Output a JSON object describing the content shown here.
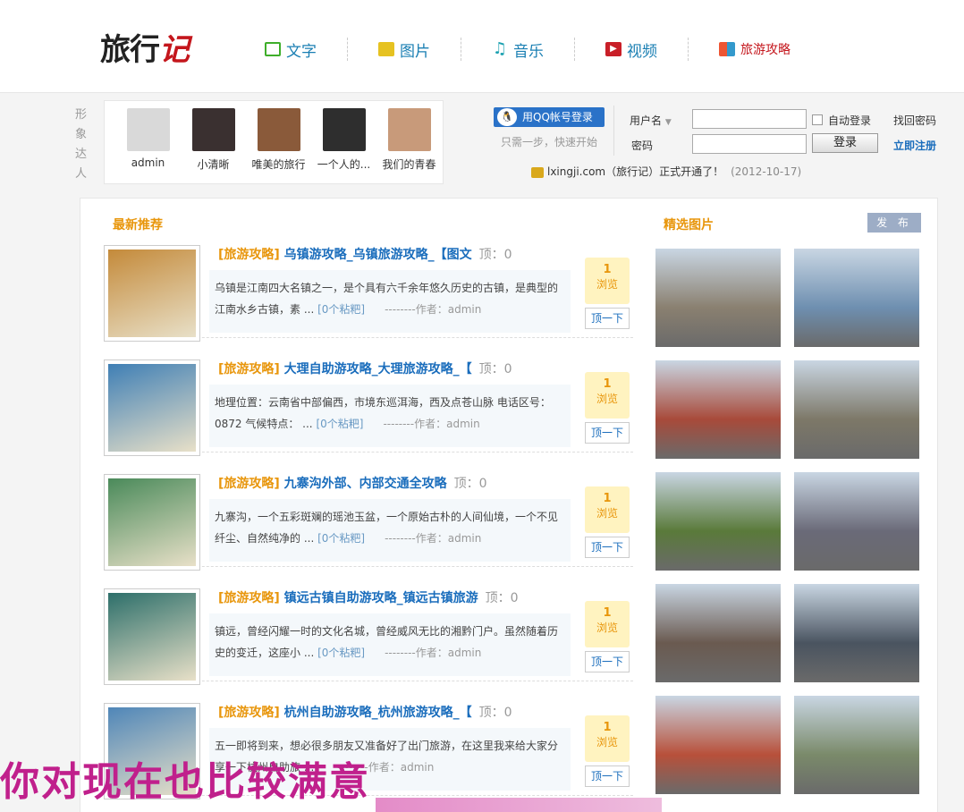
{
  "header": {
    "logo_main": "旅行",
    "logo_accent": "记",
    "nav": [
      {
        "label": "文字",
        "icon": "text-icon"
      },
      {
        "label": "图片",
        "icon": "picture-icon"
      },
      {
        "label": "音乐",
        "icon": "music-icon"
      },
      {
        "label": "视频",
        "icon": "video-icon"
      },
      {
        "label": "旅游攻略",
        "icon": "guide-icon"
      }
    ]
  },
  "stars": {
    "side_label": "形象达人",
    "users": [
      {
        "name": "admin",
        "color": "#d9d9d9"
      },
      {
        "name": "小清晰",
        "color": "#3a3030"
      },
      {
        "name": "唯美的旅行",
        "color": "#8a5a3a"
      },
      {
        "name": "一个人的...",
        "color": "#2e2e2e"
      },
      {
        "name": "我们的青春",
        "color": "#c89a7a"
      }
    ]
  },
  "login": {
    "qq_button": "用QQ帐号登录",
    "qq_sub": "只需一步，快速开始",
    "username_label": "用户名",
    "password_label": "密码",
    "auto_login": "自动登录",
    "find_password": "找回密码",
    "login_button": "登录",
    "register": "立即注册"
  },
  "notice": {
    "text": "lxingji.com（旅行记）正式开通了！",
    "date": "(2012-10-17)"
  },
  "latest": {
    "title": "最新推荐",
    "posts": [
      {
        "cat": "[旅游攻略]",
        "title": "乌镇游攻略_乌镇旅游攻略_【图文",
        "top": "顶：0",
        "body1": "乌镇是江南四大名镇之一，是个具有六千余年悠久历史的古镇，是典型的",
        "body2": "江南水乡古镇，素 ...",
        "more": "[0个粘粑]",
        "author": "--------作者：admin",
        "votes": "1",
        "vote_label": "浏览",
        "ding": "顶一下",
        "color": "#c48a3a"
      },
      {
        "cat": "[旅游攻略]",
        "title": "大理自助游攻略_大理旅游攻略_【",
        "top": "顶：0",
        "body1": "地理位置：云南省中部偏西，市境东巡洱海，西及点苍山脉 电话区号：",
        "body2": "0872 气候特点： ...",
        "more": "[0个粘粑]",
        "author": "--------作者：admin",
        "votes": "1",
        "vote_label": "浏览",
        "ding": "顶一下",
        "color": "#3f7fb5"
      },
      {
        "cat": "[旅游攻略]",
        "title": "九寨沟外部、内部交通全攻略",
        "top": "顶：0",
        "body1": "九寨沟，一个五彩斑斓的瑶池玉盆，一个原始古朴的人间仙境，一个不见",
        "body2": "纤尘、自然纯净的 ...",
        "more": "[0个粘粑]",
        "author": "--------作者：admin",
        "votes": "1",
        "vote_label": "浏览",
        "ding": "顶一下",
        "color": "#4a8a5a"
      },
      {
        "cat": "[旅游攻略]",
        "title": "镇远古镇自助游攻略_镇远古镇旅游",
        "top": "顶：0",
        "body1": "镇远，曾经闪耀一时的文化名城，曾经威风无比的湘黔门户。虽然随着历",
        "body2": "史的变迁，这座小 ...",
        "more": "[0个粘粑]",
        "author": "--------作者：admin",
        "votes": "1",
        "vote_label": "浏览",
        "ding": "顶一下",
        "color": "#2d6f6a"
      },
      {
        "cat": "[旅游攻略]",
        "title": "杭州自助游攻略_杭州旅游攻略_【",
        "top": "顶：0",
        "body1": "五一即将到来，想必很多朋友又准备好了出门旅游，在这里我来给大家分",
        "body2": "享一下杭州自助旅 ...",
        "more": "",
        "author": "--------作者：admin",
        "votes": "1",
        "vote_label": "浏览",
        "ding": "顶一下",
        "color": "#4f86b8"
      }
    ]
  },
  "gallery": {
    "title": "精选图片",
    "publish": "发 布",
    "images": [
      {
        "color": "#8a8070"
      },
      {
        "color": "#6e8fb0"
      },
      {
        "color": "#a84a3a"
      },
      {
        "color": "#7d7868"
      },
      {
        "color": "#5a7a3a"
      },
      {
        "color": "#6a6a78"
      },
      {
        "color": "#6a5a50"
      },
      {
        "color": "#4a5460"
      },
      {
        "color": "#b8503a"
      },
      {
        "color": "#7a8a6a"
      }
    ]
  },
  "watermark": "你对现在也比较满意"
}
